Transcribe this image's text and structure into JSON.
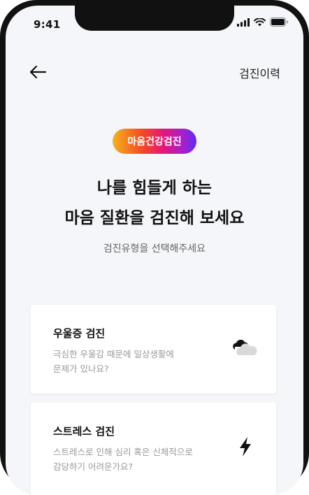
{
  "status_bar": {
    "time": "9:41"
  },
  "header": {
    "history_label": "검진이력"
  },
  "badge": {
    "label": "마음건강검진"
  },
  "hero": {
    "line1": "나를 힘들게 하는",
    "line2": "마음 질환을 검진해 보세요",
    "subtitle": "검진유형을 선택해주세요"
  },
  "cards": [
    {
      "title": "우울증 검진",
      "desc_line1": "극심한 우울감 때문에 일상생활에",
      "desc_line2": "문제가 있나요?",
      "icon": "cloud-icon"
    },
    {
      "title": "스트레스 검진",
      "desc_line1": "스트레스로 인해 심리 혹은 신체적으로",
      "desc_line2": "감당하기 어려운가요?",
      "icon": "lightning-icon"
    }
  ],
  "colors": {
    "background": "#f5f6f9",
    "card": "#ffffff",
    "badge_gradient": [
      "#f7b21b",
      "#f44a26",
      "#e6167b",
      "#a320d0",
      "#5a2ef0"
    ]
  }
}
